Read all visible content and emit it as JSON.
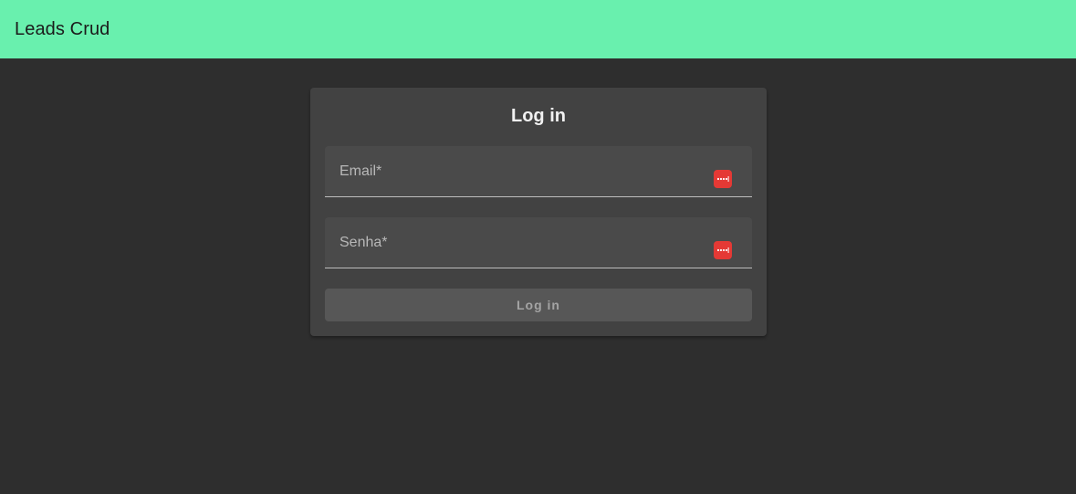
{
  "app_bar": {
    "title": "Leads Crud",
    "background_color": "#69f0ae"
  },
  "login_card": {
    "title": "Log in",
    "fields": {
      "email": {
        "label": "Email*",
        "value": "",
        "icon": "password-manager-icon"
      },
      "senha": {
        "label": "Senha*",
        "value": "",
        "icon": "password-manager-icon"
      }
    },
    "submit_label": "Log in",
    "submit_state": "disabled"
  },
  "colors": {
    "page_background": "#2e2e2e",
    "card_background": "#424242",
    "field_background": "#4a4a4a",
    "icon_badge": "#e53935"
  }
}
